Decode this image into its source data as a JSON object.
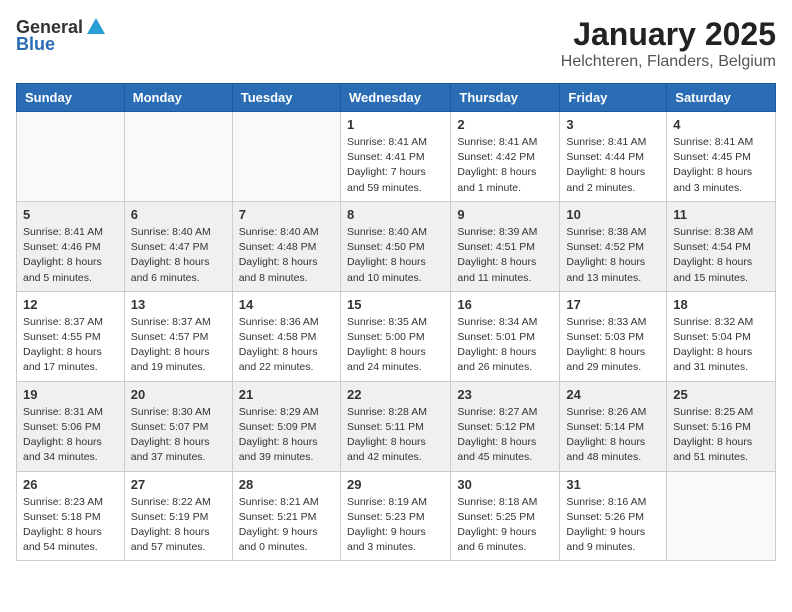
{
  "logo": {
    "general": "General",
    "blue": "Blue"
  },
  "title": {
    "month": "January 2025",
    "location": "Helchteren, Flanders, Belgium"
  },
  "headers": [
    "Sunday",
    "Monday",
    "Tuesday",
    "Wednesday",
    "Thursday",
    "Friday",
    "Saturday"
  ],
  "weeks": [
    {
      "shaded": false,
      "days": [
        {
          "number": "",
          "sunrise": "",
          "sunset": "",
          "daylight": "",
          "empty": true
        },
        {
          "number": "",
          "sunrise": "",
          "sunset": "",
          "daylight": "",
          "empty": true
        },
        {
          "number": "",
          "sunrise": "",
          "sunset": "",
          "daylight": "",
          "empty": true
        },
        {
          "number": "1",
          "sunrise": "Sunrise: 8:41 AM",
          "sunset": "Sunset: 4:41 PM",
          "daylight": "Daylight: 7 hours and 59 minutes.",
          "empty": false
        },
        {
          "number": "2",
          "sunrise": "Sunrise: 8:41 AM",
          "sunset": "Sunset: 4:42 PM",
          "daylight": "Daylight: 8 hours and 1 minute.",
          "empty": false
        },
        {
          "number": "3",
          "sunrise": "Sunrise: 8:41 AM",
          "sunset": "Sunset: 4:44 PM",
          "daylight": "Daylight: 8 hours and 2 minutes.",
          "empty": false
        },
        {
          "number": "4",
          "sunrise": "Sunrise: 8:41 AM",
          "sunset": "Sunset: 4:45 PM",
          "daylight": "Daylight: 8 hours and 3 minutes.",
          "empty": false
        }
      ]
    },
    {
      "shaded": true,
      "days": [
        {
          "number": "5",
          "sunrise": "Sunrise: 8:41 AM",
          "sunset": "Sunset: 4:46 PM",
          "daylight": "Daylight: 8 hours and 5 minutes.",
          "empty": false
        },
        {
          "number": "6",
          "sunrise": "Sunrise: 8:40 AM",
          "sunset": "Sunset: 4:47 PM",
          "daylight": "Daylight: 8 hours and 6 minutes.",
          "empty": false
        },
        {
          "number": "7",
          "sunrise": "Sunrise: 8:40 AM",
          "sunset": "Sunset: 4:48 PM",
          "daylight": "Daylight: 8 hours and 8 minutes.",
          "empty": false
        },
        {
          "number": "8",
          "sunrise": "Sunrise: 8:40 AM",
          "sunset": "Sunset: 4:50 PM",
          "daylight": "Daylight: 8 hours and 10 minutes.",
          "empty": false
        },
        {
          "number": "9",
          "sunrise": "Sunrise: 8:39 AM",
          "sunset": "Sunset: 4:51 PM",
          "daylight": "Daylight: 8 hours and 11 minutes.",
          "empty": false
        },
        {
          "number": "10",
          "sunrise": "Sunrise: 8:38 AM",
          "sunset": "Sunset: 4:52 PM",
          "daylight": "Daylight: 8 hours and 13 minutes.",
          "empty": false
        },
        {
          "number": "11",
          "sunrise": "Sunrise: 8:38 AM",
          "sunset": "Sunset: 4:54 PM",
          "daylight": "Daylight: 8 hours and 15 minutes.",
          "empty": false
        }
      ]
    },
    {
      "shaded": false,
      "days": [
        {
          "number": "12",
          "sunrise": "Sunrise: 8:37 AM",
          "sunset": "Sunset: 4:55 PM",
          "daylight": "Daylight: 8 hours and 17 minutes.",
          "empty": false
        },
        {
          "number": "13",
          "sunrise": "Sunrise: 8:37 AM",
          "sunset": "Sunset: 4:57 PM",
          "daylight": "Daylight: 8 hours and 19 minutes.",
          "empty": false
        },
        {
          "number": "14",
          "sunrise": "Sunrise: 8:36 AM",
          "sunset": "Sunset: 4:58 PM",
          "daylight": "Daylight: 8 hours and 22 minutes.",
          "empty": false
        },
        {
          "number": "15",
          "sunrise": "Sunrise: 8:35 AM",
          "sunset": "Sunset: 5:00 PM",
          "daylight": "Daylight: 8 hours and 24 minutes.",
          "empty": false
        },
        {
          "number": "16",
          "sunrise": "Sunrise: 8:34 AM",
          "sunset": "Sunset: 5:01 PM",
          "daylight": "Daylight: 8 hours and 26 minutes.",
          "empty": false
        },
        {
          "number": "17",
          "sunrise": "Sunrise: 8:33 AM",
          "sunset": "Sunset: 5:03 PM",
          "daylight": "Daylight: 8 hours and 29 minutes.",
          "empty": false
        },
        {
          "number": "18",
          "sunrise": "Sunrise: 8:32 AM",
          "sunset": "Sunset: 5:04 PM",
          "daylight": "Daylight: 8 hours and 31 minutes.",
          "empty": false
        }
      ]
    },
    {
      "shaded": true,
      "days": [
        {
          "number": "19",
          "sunrise": "Sunrise: 8:31 AM",
          "sunset": "Sunset: 5:06 PM",
          "daylight": "Daylight: 8 hours and 34 minutes.",
          "empty": false
        },
        {
          "number": "20",
          "sunrise": "Sunrise: 8:30 AM",
          "sunset": "Sunset: 5:07 PM",
          "daylight": "Daylight: 8 hours and 37 minutes.",
          "empty": false
        },
        {
          "number": "21",
          "sunrise": "Sunrise: 8:29 AM",
          "sunset": "Sunset: 5:09 PM",
          "daylight": "Daylight: 8 hours and 39 minutes.",
          "empty": false
        },
        {
          "number": "22",
          "sunrise": "Sunrise: 8:28 AM",
          "sunset": "Sunset: 5:11 PM",
          "daylight": "Daylight: 8 hours and 42 minutes.",
          "empty": false
        },
        {
          "number": "23",
          "sunrise": "Sunrise: 8:27 AM",
          "sunset": "Sunset: 5:12 PM",
          "daylight": "Daylight: 8 hours and 45 minutes.",
          "empty": false
        },
        {
          "number": "24",
          "sunrise": "Sunrise: 8:26 AM",
          "sunset": "Sunset: 5:14 PM",
          "daylight": "Daylight: 8 hours and 48 minutes.",
          "empty": false
        },
        {
          "number": "25",
          "sunrise": "Sunrise: 8:25 AM",
          "sunset": "Sunset: 5:16 PM",
          "daylight": "Daylight: 8 hours and 51 minutes.",
          "empty": false
        }
      ]
    },
    {
      "shaded": false,
      "days": [
        {
          "number": "26",
          "sunrise": "Sunrise: 8:23 AM",
          "sunset": "Sunset: 5:18 PM",
          "daylight": "Daylight: 8 hours and 54 minutes.",
          "empty": false
        },
        {
          "number": "27",
          "sunrise": "Sunrise: 8:22 AM",
          "sunset": "Sunset: 5:19 PM",
          "daylight": "Daylight: 8 hours and 57 minutes.",
          "empty": false
        },
        {
          "number": "28",
          "sunrise": "Sunrise: 8:21 AM",
          "sunset": "Sunset: 5:21 PM",
          "daylight": "Daylight: 9 hours and 0 minutes.",
          "empty": false
        },
        {
          "number": "29",
          "sunrise": "Sunrise: 8:19 AM",
          "sunset": "Sunset: 5:23 PM",
          "daylight": "Daylight: 9 hours and 3 minutes.",
          "empty": false
        },
        {
          "number": "30",
          "sunrise": "Sunrise: 8:18 AM",
          "sunset": "Sunset: 5:25 PM",
          "daylight": "Daylight: 9 hours and 6 minutes.",
          "empty": false
        },
        {
          "number": "31",
          "sunrise": "Sunrise: 8:16 AM",
          "sunset": "Sunset: 5:26 PM",
          "daylight": "Daylight: 9 hours and 9 minutes.",
          "empty": false
        },
        {
          "number": "",
          "sunrise": "",
          "sunset": "",
          "daylight": "",
          "empty": true
        }
      ]
    }
  ]
}
